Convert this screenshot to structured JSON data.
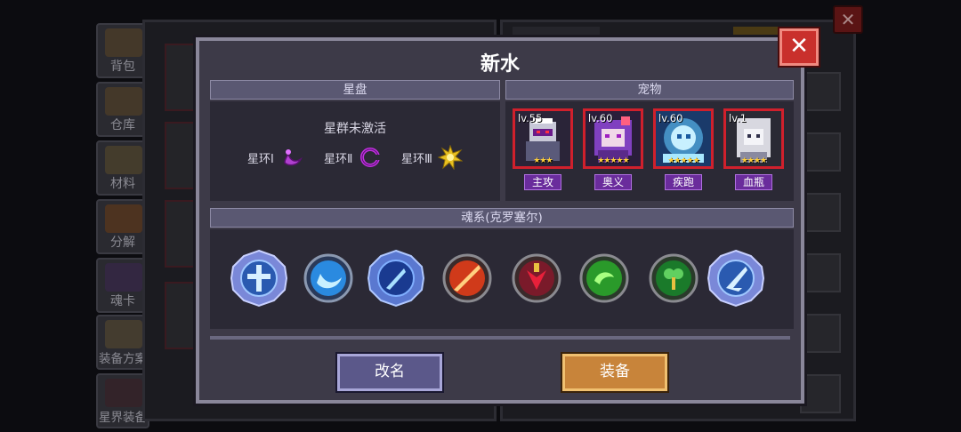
{
  "background": {
    "side_menu": [
      "背包",
      "仓库",
      "材料",
      "分解",
      "魂卡",
      "装备方案",
      "星界装备"
    ],
    "close_symbol": "✕"
  },
  "modal": {
    "title": "新水",
    "close_symbol": "✕",
    "starmap": {
      "header": "星盘",
      "status": "星群未激活",
      "rings": [
        {
          "label": "星环Ⅰ",
          "icon": "purple-crescent-icon",
          "color": "#b040d0"
        },
        {
          "label": "星环Ⅱ",
          "icon": "purple-ring-icon",
          "color": "#c030e0"
        },
        {
          "label": "星环Ⅲ",
          "icon": "gold-sun-icon",
          "color": "#e8c020"
        }
      ]
    },
    "pets": {
      "header": "宠物",
      "items": [
        {
          "level": "lv.55",
          "role": "主攻",
          "stars": "★★★",
          "icon": "armored-knight-pet-icon"
        },
        {
          "level": "lv.60",
          "role": "奥义",
          "stars": "★★★★★",
          "icon": "purple-hair-girl-pet-icon"
        },
        {
          "level": "lv.60",
          "role": "疾跑",
          "stars": "★★★★★",
          "icon": "ice-spirit-pet-icon"
        },
        {
          "level": "lv.1",
          "role": "血瓶",
          "stars": "★★★★",
          "icon": "white-hair-ghost-pet-icon"
        }
      ]
    },
    "soul": {
      "header": "魂系(克罗塞尔)",
      "icons": [
        "ice-cross-emblem-icon",
        "blue-crescent-orb-icon",
        "ice-feather-emblem-icon",
        "red-spear-orb-icon",
        "red-orb-with-gold-icon",
        "green-serpent-orb-icon",
        "green-clover-orb-icon",
        "ice-blade-emblem-icon"
      ]
    },
    "buttons": {
      "rename": "改名",
      "equip": "装备"
    }
  }
}
